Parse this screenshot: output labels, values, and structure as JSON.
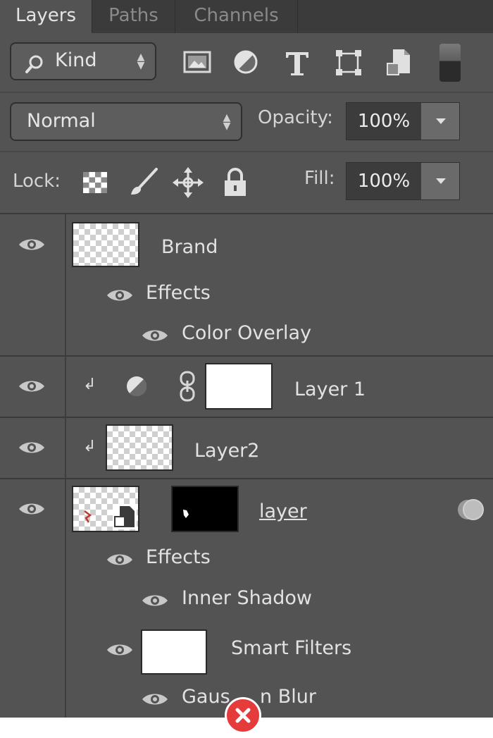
{
  "tabs": [
    {
      "label": "Layers"
    },
    {
      "label": "Paths"
    },
    {
      "label": "Channels"
    }
  ],
  "filter": {
    "kind_label": "Kind",
    "icons": [
      "image-filter-icon",
      "adjustment-filter-icon",
      "type-filter-icon",
      "shape-filter-icon",
      "smart-object-filter-icon"
    ]
  },
  "blend": {
    "mode": "Normal",
    "opacity_label": "Opacity:",
    "opacity_value": "100%"
  },
  "lock": {
    "label": "Lock:",
    "fill_label": "Fill:",
    "fill_value": "100%"
  },
  "layers": {
    "brand": {
      "name": "Brand",
      "effects": "Effects",
      "effect1": "Color Overlay"
    },
    "layer1": {
      "name": "Layer 1"
    },
    "layer2": {
      "name": "Layer2"
    },
    "layer": {
      "name": "layer",
      "effects": "Effects",
      "effect1": "Inner Shadow",
      "smart_filters": "Smart Filters",
      "filter1_left": "Gaus",
      "filter1_right": "n Blur"
    }
  },
  "colors": {
    "panel": "#535353",
    "tabbar": "#3b3b3b",
    "close_badge": "#e63b3b"
  }
}
